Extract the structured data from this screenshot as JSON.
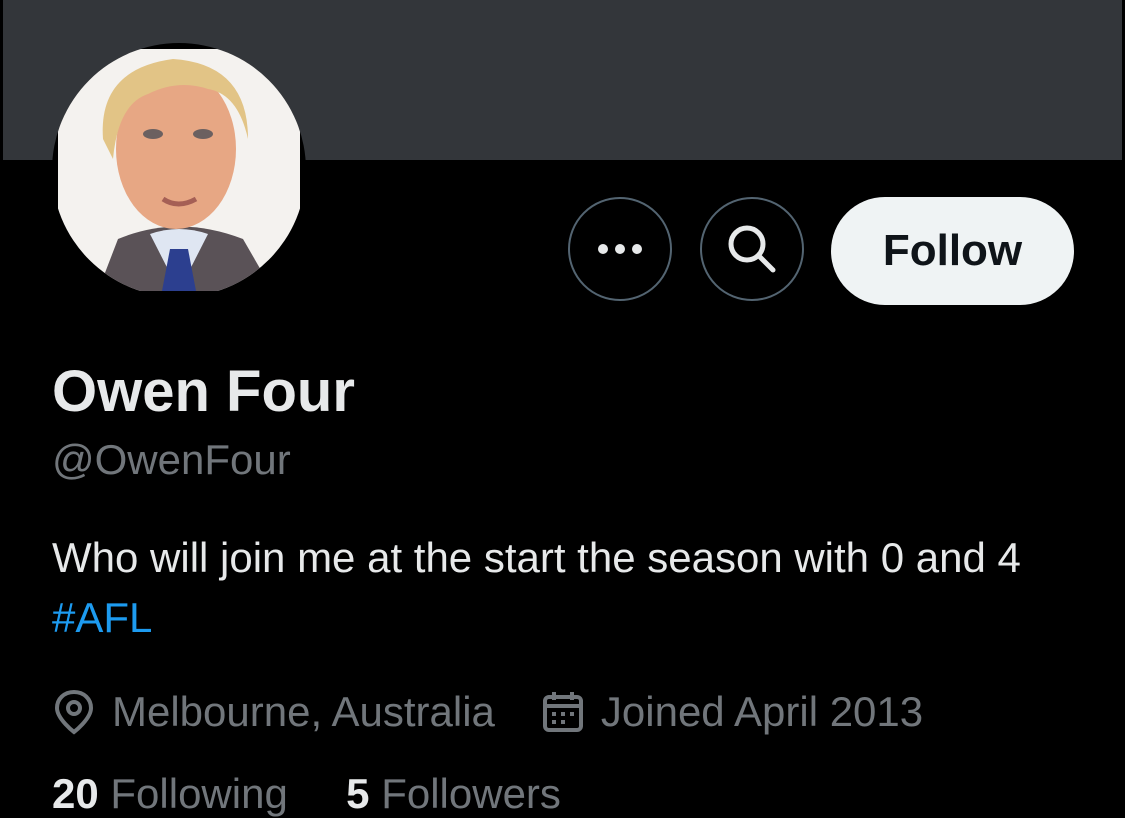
{
  "profile": {
    "name": "Owen Four",
    "handle": "@OwenFour",
    "bio_text": "Who will join me at the start the season with 0 and 4 ",
    "bio_hashtag": "#AFL",
    "location": "Melbourne, Australia",
    "joined": "Joined April 2013"
  },
  "actions": {
    "follow_label": "Follow",
    "more_icon": "more-horizontal-icon",
    "search_icon": "search-icon"
  },
  "stats": {
    "following_count": "20",
    "following_label": "Following",
    "followers_count": "5",
    "followers_label": "Followers"
  },
  "colors": {
    "background": "#000000",
    "banner": "#33363a",
    "accent": "#1d9bf0",
    "muted": "#71767b",
    "text": "#e7e9ea",
    "follow_bg": "#eff3f4"
  }
}
